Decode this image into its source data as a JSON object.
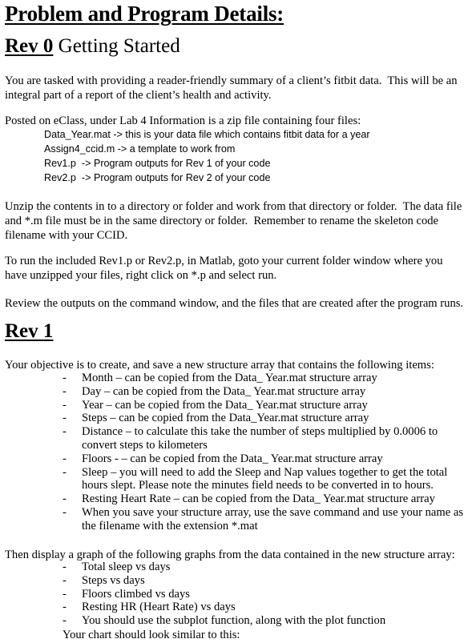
{
  "document": {
    "title": "Problem and Program Details:",
    "rev0": {
      "heading_bold": "Rev 0",
      "heading_rest": " Getting Started",
      "intro": [
        "You are tasked with providing a reader-friendly summary of a client’s fitbit data.  This will be an",
        "integral part of a report of the client’s health and activity."
      ],
      "posted_line": "Posted on eClass, under Lab 4 Information is a zip file containing four files:",
      "files": [
        "Data_Year.mat -> this is your data file which contains fitbit data for a year",
        "Assign4_ccid.m -> a template to work from",
        "Rev1.p  -> Program outputs for Rev 1 of your code",
        "Rev2.p  -> Program outputs for Rev 2 of your code"
      ],
      "unzip": [
        "Unzip the contents in to a directory or folder and work from that directory or folder.  The data file",
        "and *.m file must be in the same directory or folder.  Remember to rename the skeleton code",
        "filename with your CCID."
      ],
      "run": [
        "To run the included Rev1.p or Rev2.p, in Matlab, goto your current folder window where you",
        "have unzipped your files, right click on *.p and select run."
      ],
      "review": "Review the outputs on the command window, and the files that are created after the program runs."
    },
    "rev1": {
      "heading": "Rev 1",
      "objective": "Your objective is to create, and save a new structure array that contains the following items:",
      "items": [
        {
          "lines": [
            "Month – can be copied from the Data_ Year.mat structure array"
          ]
        },
        {
          "lines": [
            "Day – can be copied from the Data_ Year.mat structure array"
          ]
        },
        {
          "lines": [
            "Year – can be copied from the Data_ Year.mat structure array"
          ]
        },
        {
          "lines": [
            "Steps – can be copied from the Data_Year.mat structure array"
          ]
        },
        {
          "lines": [
            "Distance – to calculate this take the number of steps multiplied by 0.0006 to",
            "convert steps to kilometers"
          ]
        },
        {
          "lines": [
            "Floors - – can be copied from the Data_ Year.mat structure array"
          ]
        },
        {
          "lines": [
            "Sleep – you will need to add the Sleep and Nap values together to get the total",
            "hours slept.  Please note the minutes field needs to be converted in to hours."
          ]
        },
        {
          "lines": [
            "Resting Heart Rate – can be copied from the Data_ Year.mat structure array"
          ]
        },
        {
          "lines": [
            "When you save your structure array, use the save command and use your name as",
            "the filename with the extension *.mat"
          ]
        }
      ],
      "graphs_intro": "Then display a graph of the following graphs from the data contained in the new structure array:",
      "graphs": [
        "Total sleep vs days",
        "Steps vs days",
        "Floors climbed vs days",
        "Resting HR (Heart Rate) vs days",
        "You should use the subplot function, along with the plot function"
      ],
      "chart_note": "Your chart should look similar to this:"
    },
    "bullet_glyph": "-"
  }
}
